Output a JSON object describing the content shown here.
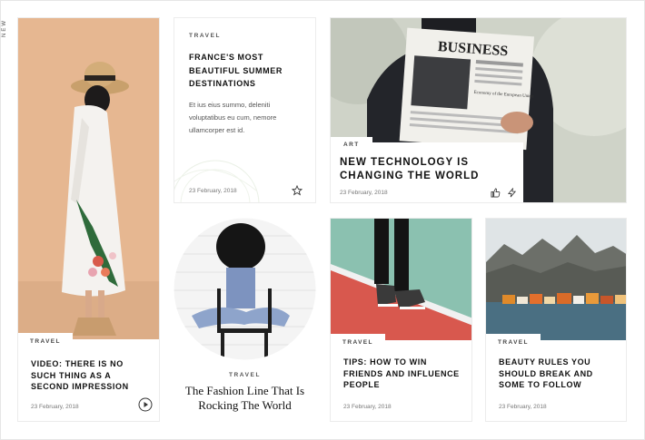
{
  "side_label": "NEW",
  "cards": {
    "woman": {
      "category": "TRAVEL",
      "title": "VIDEO: THERE IS NO SUCH THING AS A SECOND IMPRESSION",
      "date": "23 February, 2018",
      "icon": "play-icon"
    },
    "france": {
      "category": "TRAVEL",
      "title": "FRANCE'S MOST BEAUTIFUL SUMMER DESTINATIONS",
      "excerpt": "Et ius eius summo, deleniti voluptatibus eu cum, nemore ullamcorper est id.",
      "date": "23 February, 2018",
      "icon": "star-icon"
    },
    "tech": {
      "category": "ART",
      "title": "NEW TECHNOLOGY IS CHANGING THE WORLD",
      "date": "23 February, 2018",
      "newspaper_masthead": "BUSINESS",
      "newspaper_sub": "Economy of the European Union",
      "icons": [
        "thumbs-up-icon",
        "lightning-icon"
      ]
    },
    "fashion": {
      "category": "TRAVEL",
      "title": "The Fashion Line That Is Rocking The World"
    },
    "tips": {
      "category": "TRAVEL",
      "title": "TIPS: HOW TO WIN FRIENDS AND INFLUENCE PEOPLE",
      "date": "23 February, 2018"
    },
    "beauty": {
      "category": "TRAVEL",
      "title": "BEAUTY RULES YOU SHOULD BREAK AND SOME TO FOLLOW",
      "date": "23 February, 2018"
    }
  },
  "colors": {
    "peach": "#e6b791",
    "court_red": "#d8584e",
    "court_teal": "#8bc1b0"
  }
}
